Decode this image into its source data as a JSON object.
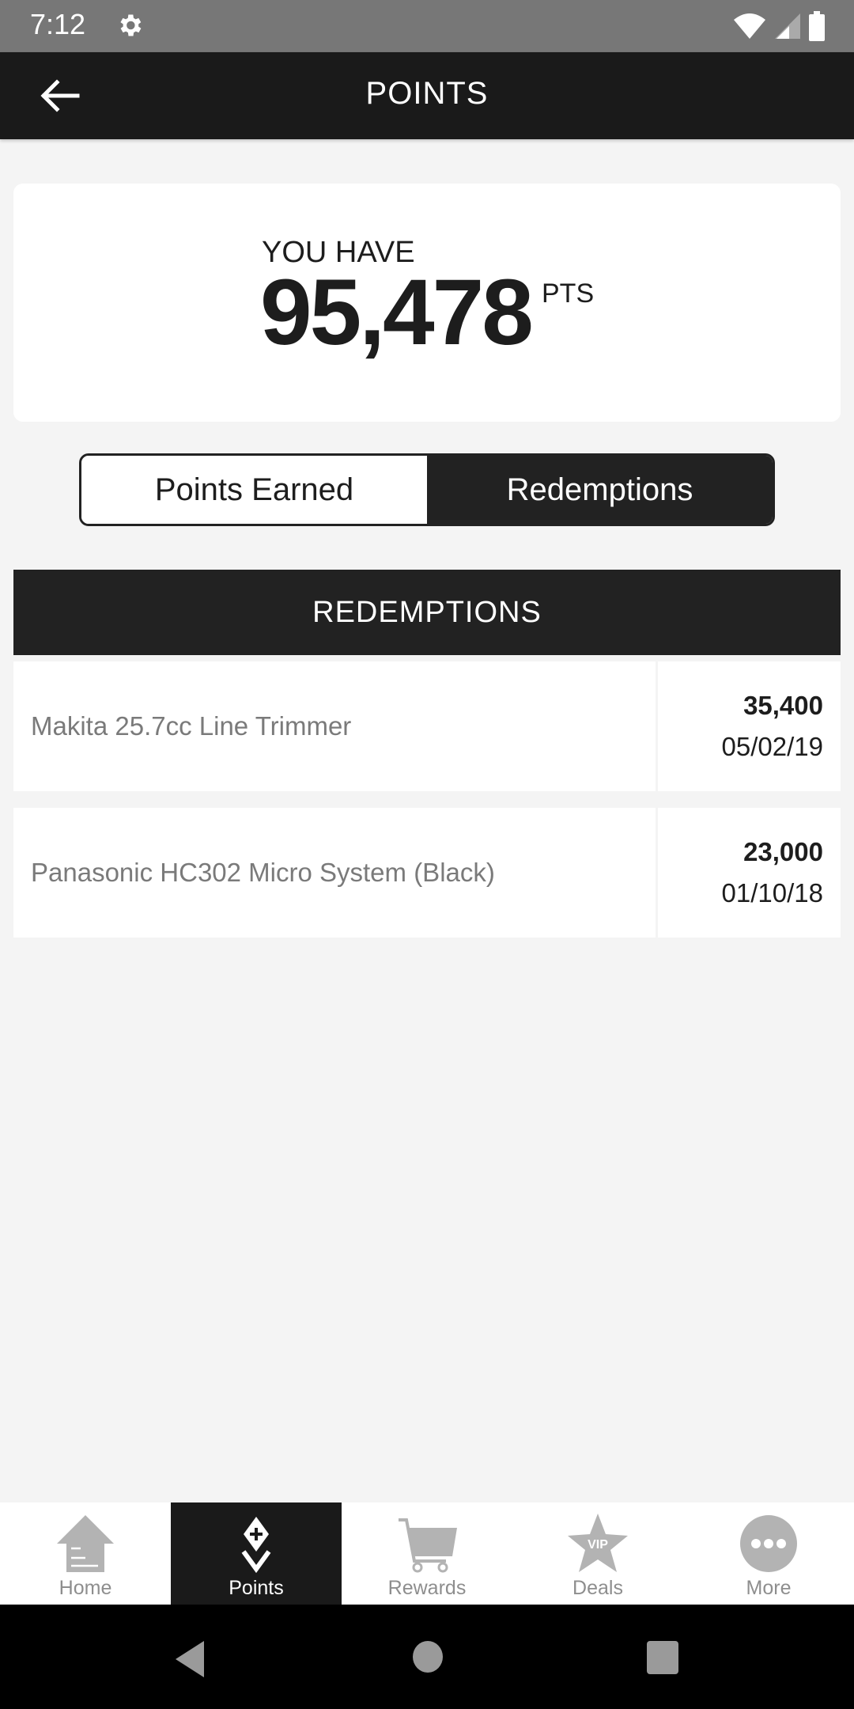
{
  "status_bar": {
    "time": "7:12",
    "icons": [
      "settings-icon",
      "wifi-icon",
      "signal-icon",
      "battery-icon"
    ]
  },
  "app_bar": {
    "title": "POINTS",
    "back_icon": "arrow-left-icon"
  },
  "points_card": {
    "label": "YOU HAVE",
    "value": "95,478",
    "unit": "PTS"
  },
  "toggle": {
    "options": [
      {
        "label": "Points Earned",
        "selected": false
      },
      {
        "label": "Redemptions",
        "selected": true
      }
    ]
  },
  "redemptions": {
    "header": "REDEMPTIONS",
    "rows": [
      {
        "name": "Makita 25.7cc Line Trimmer",
        "points": "35,400",
        "date": "05/02/19"
      },
      {
        "name": "Panasonic HC302 Micro System (Black)",
        "points": "23,000",
        "date": "01/10/18"
      }
    ]
  },
  "bottom_nav": {
    "items": [
      {
        "label": "Home",
        "icon": "home-icon",
        "active": false
      },
      {
        "label": "Points",
        "icon": "points-icon",
        "active": true
      },
      {
        "label": "Rewards",
        "icon": "cart-icon",
        "active": false
      },
      {
        "label": "Deals",
        "icon": "vip-star-icon",
        "active": false
      },
      {
        "label": "More",
        "icon": "more-icon",
        "active": false
      }
    ]
  },
  "colors": {
    "status_bar": "#777777",
    "app_bar": "#1a1a1a",
    "background": "#f4f4f4",
    "accent_dark": "#222222",
    "inactive_icon": "#b3b3b3"
  }
}
